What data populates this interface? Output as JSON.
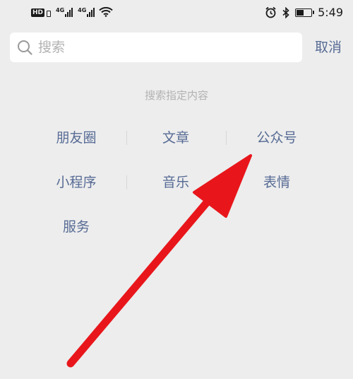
{
  "status_bar": {
    "hd_badge": "HD",
    "network_1": "4G",
    "network_2": "4G",
    "battery_level": 0.55,
    "time": "5:49"
  },
  "search": {
    "placeholder": "搜索",
    "cancel_label": "取消"
  },
  "hint": "搜索指定内容",
  "categories": [
    {
      "label": "朋友圈"
    },
    {
      "label": "文章"
    },
    {
      "label": "公众号"
    },
    {
      "label": "小程序"
    },
    {
      "label": "音乐"
    },
    {
      "label": "表情"
    },
    {
      "label": "服务"
    }
  ],
  "colors": {
    "link": "#576b95",
    "hint": "#b2b2b2",
    "background": "#ededed",
    "annotation_arrow": "#e8161b"
  }
}
